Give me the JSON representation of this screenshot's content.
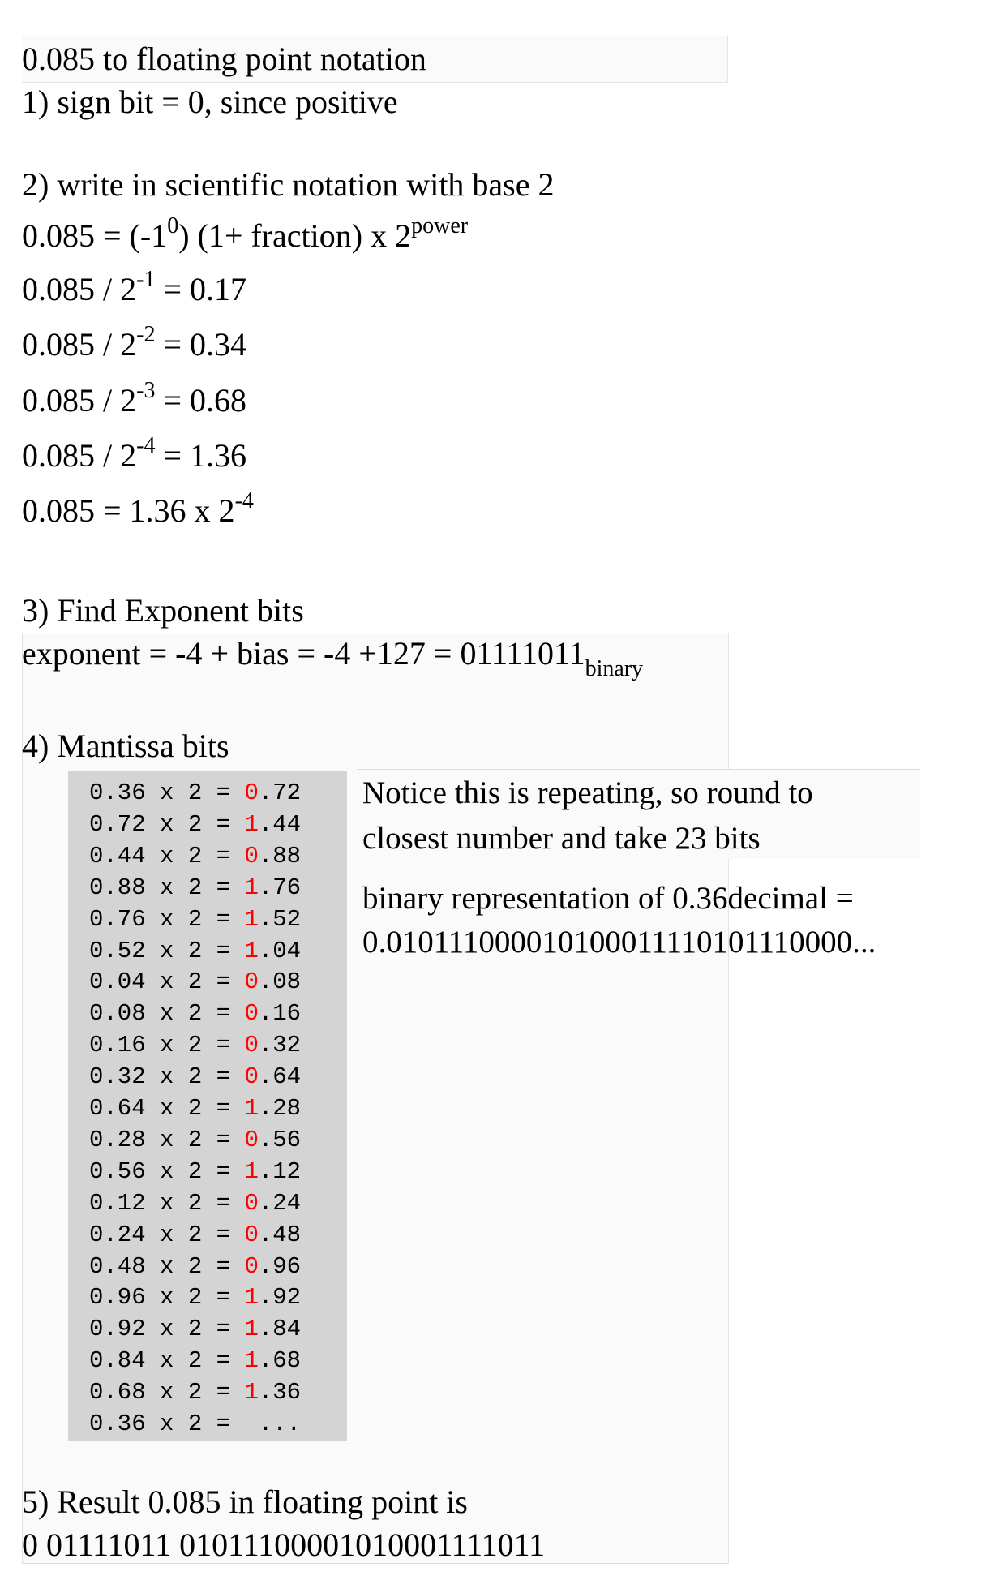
{
  "title": "0.085 to floating point notation",
  "step1": {
    "text": "1) sign bit = 0, since positive"
  },
  "step2": {
    "heading": "2) write in scientific notation with base 2",
    "formula": {
      "lhs": "0.085 = (-1",
      "sign_exp": "0",
      "mid": ") (1+ fraction) x 2",
      "power": "power"
    },
    "divisions": [
      {
        "base": "0.085 / 2",
        "exp": "-1",
        "result": " = 0.17"
      },
      {
        "base": "0.085 / 2",
        "exp": "-2",
        "result": " = 0.34"
      },
      {
        "base": "0.085 / 2",
        "exp": "-3",
        "result": " = 0.68"
      },
      {
        "base": "0.085 / 2",
        "exp": "-4",
        "result": " = 1.36"
      }
    ],
    "conclusion": {
      "base": "0.085 = 1.36 x 2",
      "exp": "-4"
    }
  },
  "step3": {
    "heading": "3) Find Exponent bits",
    "expr": "exponent = -4 + bias = -4 +127 = 01111011",
    "subscript": "binary"
  },
  "step4": {
    "heading": "4) Mantissa bits",
    "rows": [
      {
        "lhs": "0.36 x 2 = ",
        "bit": "0",
        "frac": ".72"
      },
      {
        "lhs": "0.72 x 2 = ",
        "bit": "1",
        "frac": ".44"
      },
      {
        "lhs": "0.44 x 2 = ",
        "bit": "0",
        "frac": ".88"
      },
      {
        "lhs": "0.88 x 2 = ",
        "bit": "1",
        "frac": ".76"
      },
      {
        "lhs": "0.76 x 2 = ",
        "bit": "1",
        "frac": ".52"
      },
      {
        "lhs": "0.52 x 2 = ",
        "bit": "1",
        "frac": ".04"
      },
      {
        "lhs": "0.04 x 2 = ",
        "bit": "0",
        "frac": ".08"
      },
      {
        "lhs": "0.08 x 2 = ",
        "bit": "0",
        "frac": ".16"
      },
      {
        "lhs": "0.16 x 2 = ",
        "bit": "0",
        "frac": ".32"
      },
      {
        "lhs": "0.32 x 2 = ",
        "bit": "0",
        "frac": ".64"
      },
      {
        "lhs": "0.64 x 2 = ",
        "bit": "1",
        "frac": ".28"
      },
      {
        "lhs": "0.28 x 2 = ",
        "bit": "0",
        "frac": ".56"
      },
      {
        "lhs": "0.56 x 2 = ",
        "bit": "1",
        "frac": ".12"
      },
      {
        "lhs": "0.12 x 2 = ",
        "bit": "0",
        "frac": ".24"
      },
      {
        "lhs": "0.24 x 2 = ",
        "bit": "0",
        "frac": ".48"
      },
      {
        "lhs": "0.48 x 2 = ",
        "bit": "0",
        "frac": ".96"
      },
      {
        "lhs": "0.96 x 2 = ",
        "bit": "1",
        "frac": ".92"
      },
      {
        "lhs": "0.92 x 2 = ",
        "bit": "1",
        "frac": ".84"
      },
      {
        "lhs": "0.84 x 2 = ",
        "bit": "1",
        "frac": ".68"
      },
      {
        "lhs": "0.68 x 2 = ",
        "bit": "1",
        "frac": ".36"
      },
      {
        "lhs": "0.36 x 2 = ",
        "bit": "",
        "frac": " ..."
      }
    ],
    "notice_line1": "Notice this is repeating, so round to",
    "notice_line2": "closest number and take 23 bits",
    "binary_line1": "binary representation of 0.36decimal =",
    "binary_line2": "0.010111000010100011110101110000..."
  },
  "step5": {
    "heading": "5) Result 0.085 in floating point is",
    "result": "0 01111011 01011100001010001111011"
  },
  "colors": {
    "bit_highlight": "#ff0000",
    "table_background": "#d4d4d4",
    "panel_background": "#fafafa"
  }
}
